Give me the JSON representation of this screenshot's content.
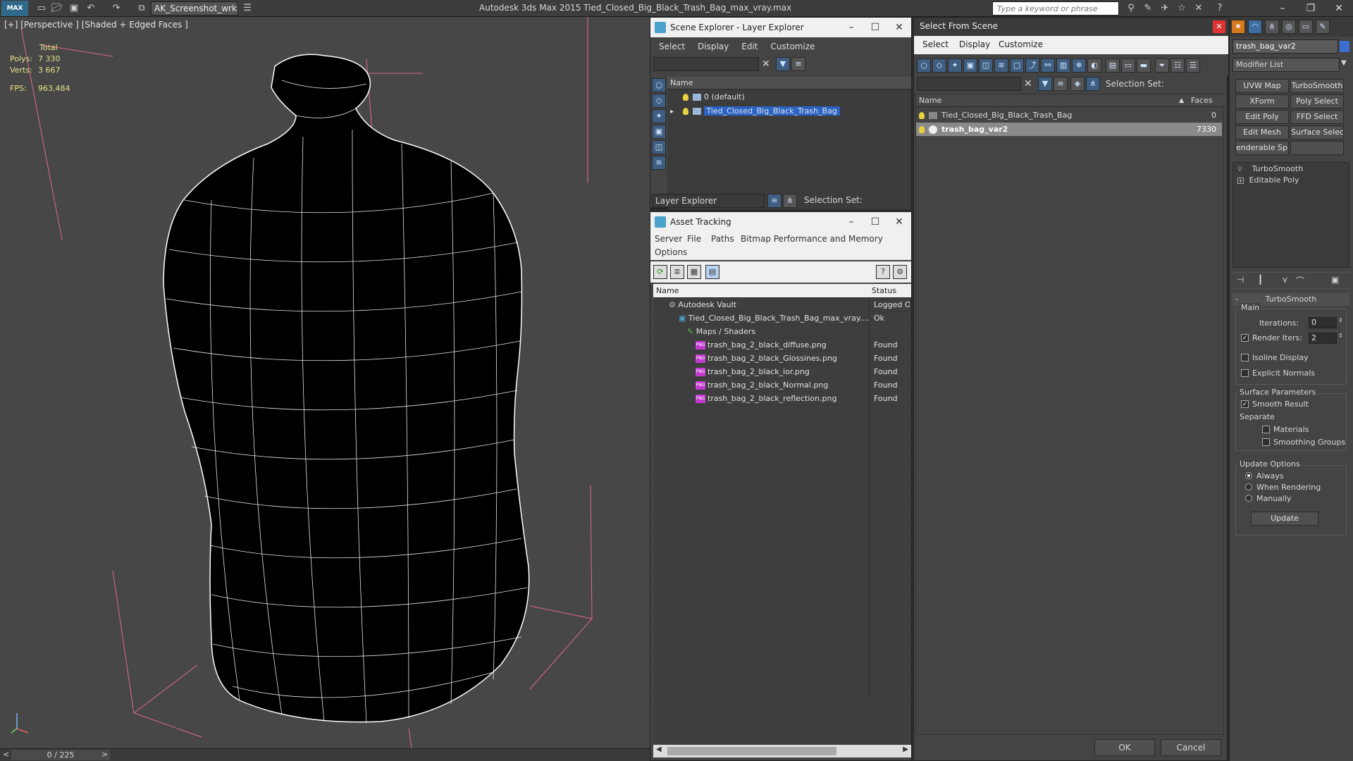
{
  "app": {
    "workspace": "AK_Screenshot_wrksp",
    "title": "Autodesk 3ds Max  2015     Tied_Closed_Big_Black_Trash_Bag_max_vray.max",
    "search_placeholder": "Type a keyword or phrase"
  },
  "viewport": {
    "label": "[+] [Perspective ] [Shaded + Edged Faces ]",
    "stats_header": "Total",
    "polys_label": "Polys:",
    "polys_value": "7 330",
    "verts_label": "Verts:",
    "verts_value": "3 667",
    "fps_label": "FPS:",
    "fps_value": "963,484"
  },
  "statusbar": {
    "time": "0 / 225"
  },
  "scene_explorer": {
    "title": "Scene Explorer - Layer Explorer",
    "menu": [
      "Select",
      "Display",
      "Edit",
      "Customize"
    ],
    "col_name": "Name",
    "rows": [
      "0 (default)",
      "Tied_Closed_Big_Black_Trash_Bag"
    ],
    "layer_dropdown": "Layer Explorer",
    "selection_set": "Selection Set:"
  },
  "asset_tracking": {
    "title": "Asset Tracking",
    "menu": [
      "Server",
      "File",
      "Paths",
      "Bitmap Performance and Memory"
    ],
    "menu2": "Options",
    "col_name": "Name",
    "col_status": "Status",
    "rows": [
      {
        "name": "Autodesk Vault",
        "status": "Logged Ou",
        "indent": 0
      },
      {
        "name": "Tied_Closed_Big_Black_Trash_Bag_max_vray....",
        "status": "Ok",
        "indent": 1
      },
      {
        "name": "Maps / Shaders",
        "status": "",
        "indent": 2
      },
      {
        "name": "trash_bag_2_black_diffuse.png",
        "status": "Found",
        "indent": 3
      },
      {
        "name": "trash_bag_2_black_Glossines.png",
        "status": "Found",
        "indent": 3
      },
      {
        "name": "trash_bag_2_black_ior.png",
        "status": "Found",
        "indent": 3
      },
      {
        "name": "trash_bag_2_black_Normal.png",
        "status": "Found",
        "indent": 3
      },
      {
        "name": "trash_bag_2_black_reflection.png",
        "status": "Found",
        "indent": 3
      }
    ]
  },
  "select_from_scene": {
    "title": "Select From Scene",
    "menu": [
      "Select",
      "Display",
      "Customize"
    ],
    "selection_set": "Selection Set:",
    "col_name": "Name",
    "col_faces": "Faces",
    "rows": [
      {
        "name": "Tied_Closed_Big_Black_Trash_Bag",
        "faces": "0"
      },
      {
        "name": "trash_bag_var2",
        "faces": "7330"
      }
    ],
    "ok": "OK",
    "cancel": "Cancel"
  },
  "command_panel": {
    "object_name": "trash_bag_var2",
    "modifier_list": "Modifier List",
    "buttons": [
      "UVW Map",
      "TurboSmooth",
      "XForm",
      "Poly Select",
      "Edit Poly",
      "FFD Select",
      "Edit Mesh",
      "Surface Select",
      "enderable Splin",
      ""
    ],
    "stack": [
      "TurboSmooth",
      "Editable Poly"
    ],
    "rollout_title": "TurboSmooth",
    "main": "Main",
    "iterations_label": "Iterations:",
    "iterations_value": "0",
    "render_iters_label": "Render Iters:",
    "render_iters_value": "2",
    "isoline": "Isoline Display",
    "explicit_normals": "Explicit Normals",
    "surface_params": "Surface Parameters",
    "smooth_result": "Smooth Result",
    "separate": "Separate",
    "materials": "Materials",
    "smoothing_groups": "Smoothing Groups",
    "update_options": "Update Options",
    "always": "Always",
    "when_rendering": "When Rendering",
    "manually": "Manually",
    "update": "Update"
  }
}
